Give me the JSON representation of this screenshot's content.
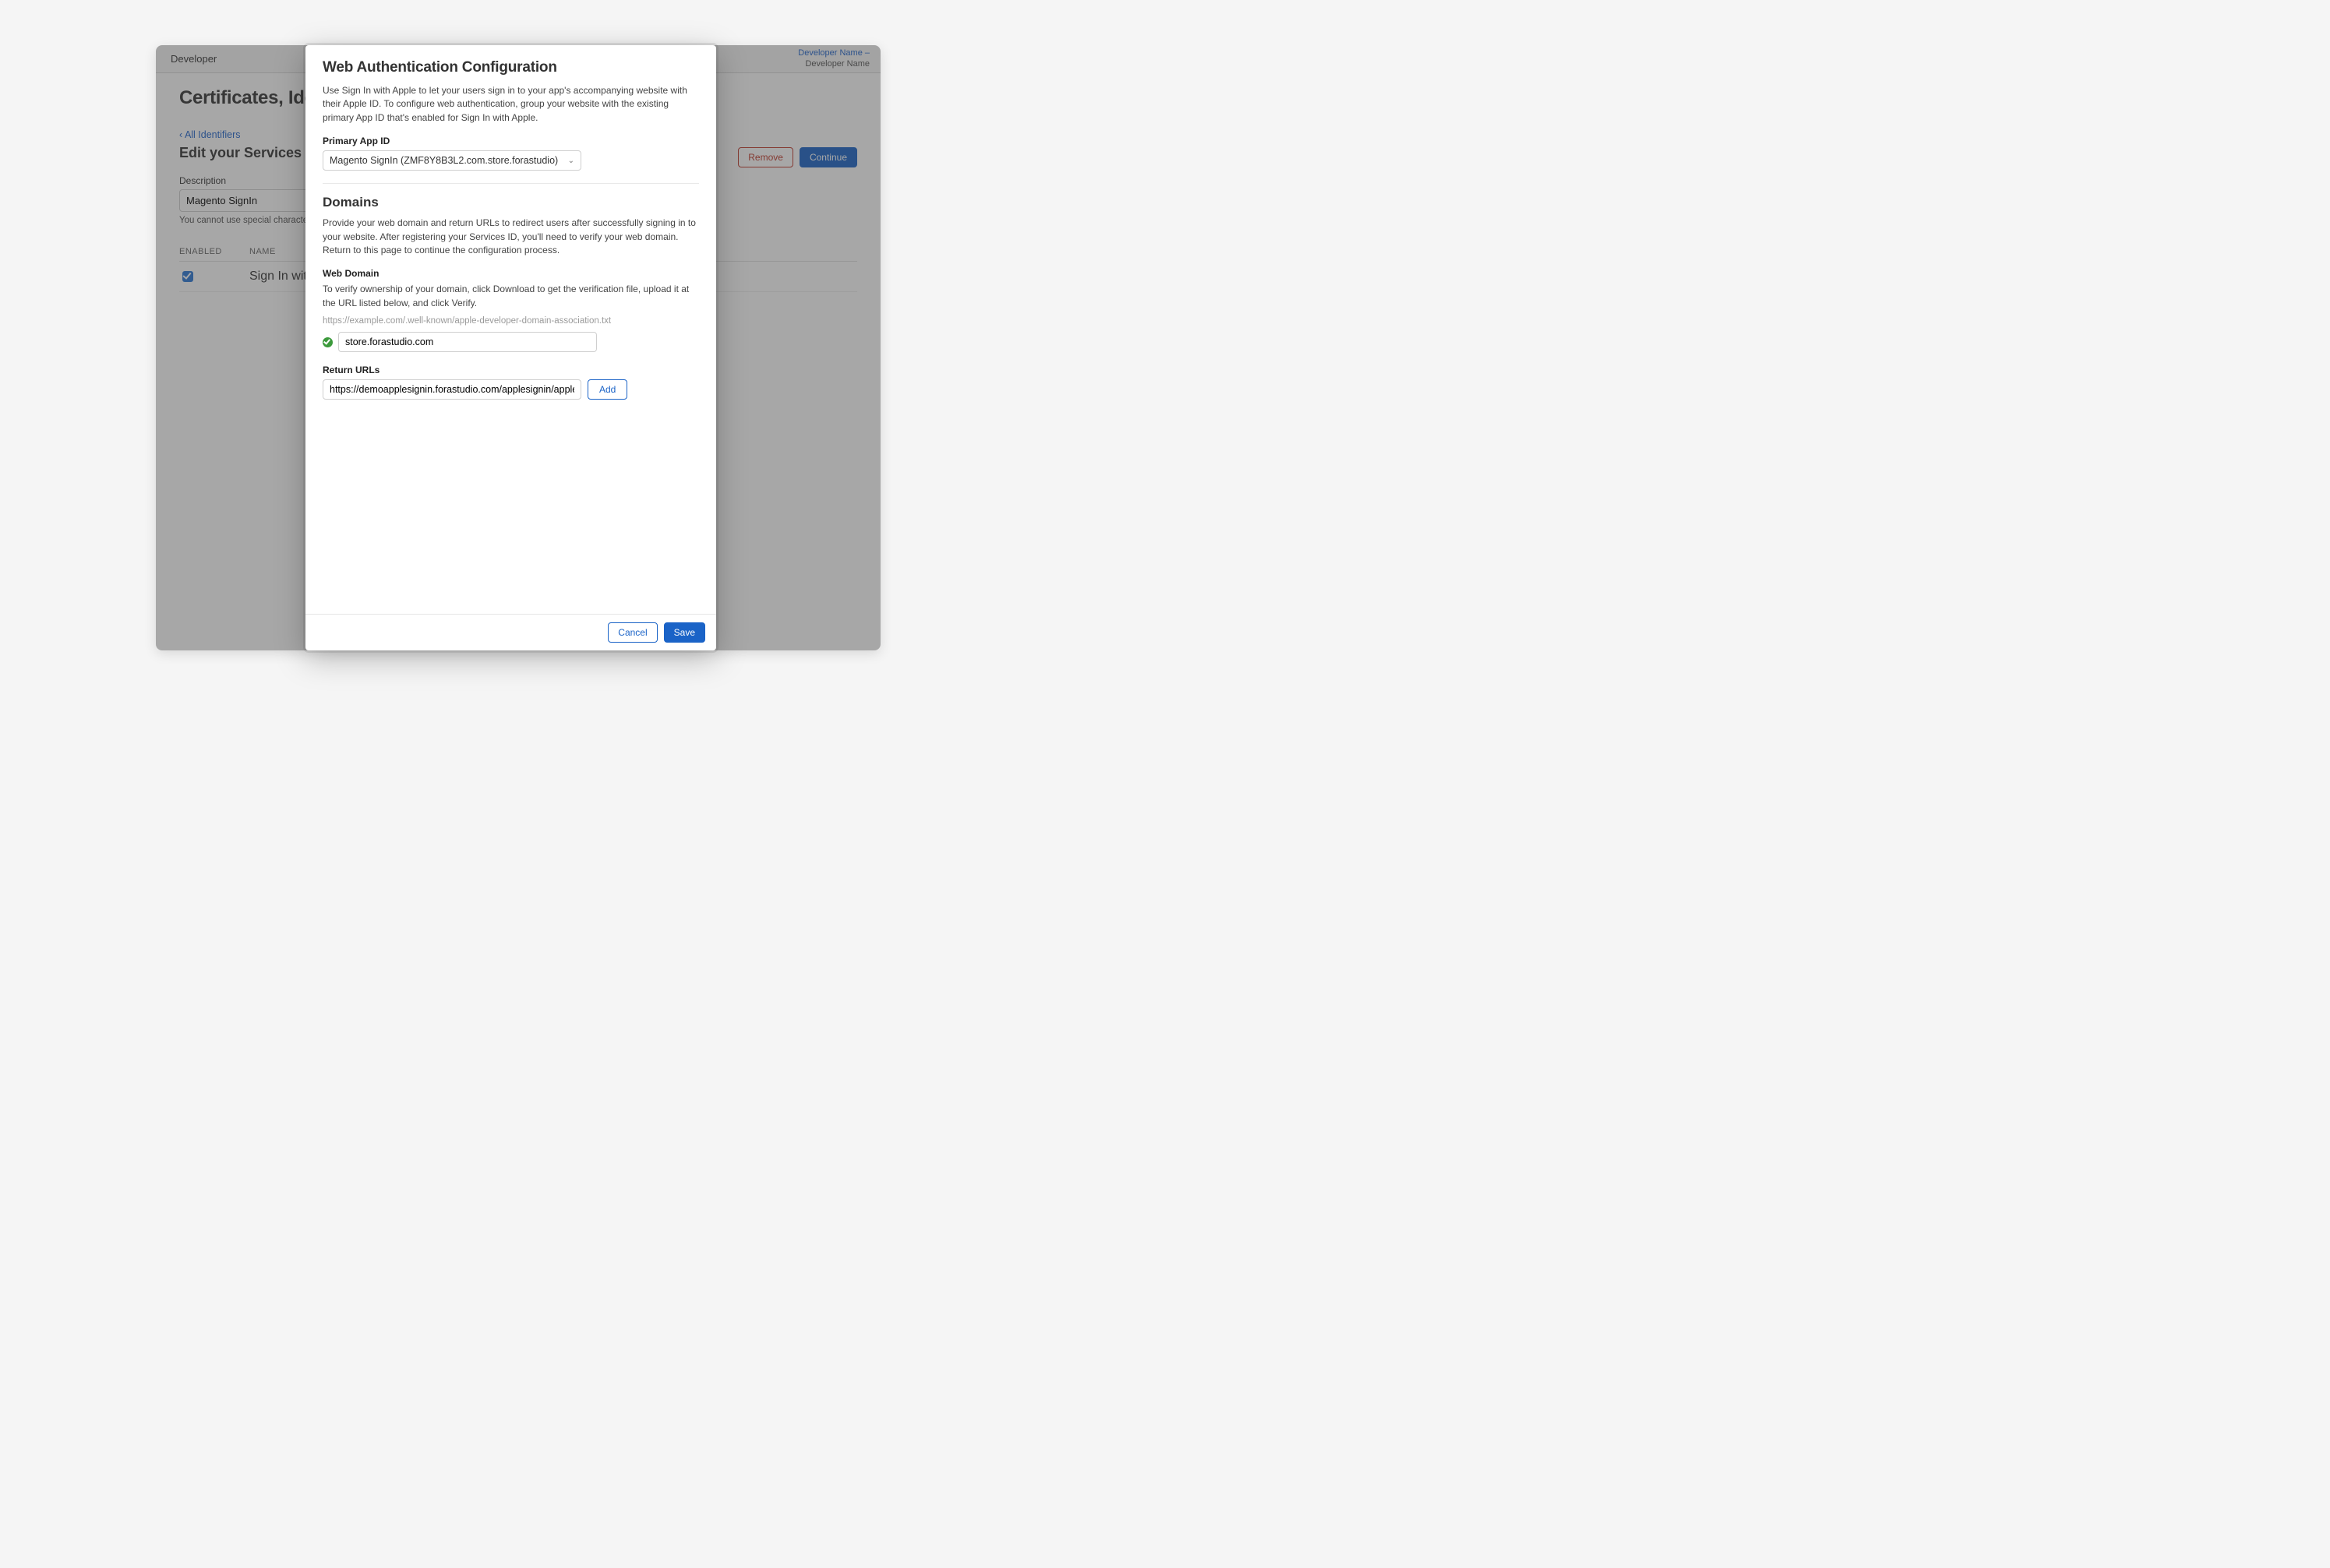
{
  "header": {
    "brand": "Developer",
    "account_line1": "Developer Name –",
    "account_line2": "Developer Name"
  },
  "page": {
    "title": "Certificates, Identifiers & Profiles",
    "back_link": "‹ All Identifiers",
    "subtitle": "Edit your Services ID Configuration",
    "remove_btn": "Remove",
    "continue_btn": "Continue",
    "description_label": "Description",
    "description_value": "Magento SignIn",
    "description_help": "You cannot use special characters such as @, &, *, \"",
    "cap_col_enabled": "ENABLED",
    "cap_col_name": "NAME",
    "cap_row_name": "Sign In with Apple"
  },
  "modal": {
    "title": "Web Authentication Configuration",
    "intro": "Use Sign In with Apple to let your users sign in to your app's accompanying website with their Apple ID. To configure web authentication, group your website with the existing primary App ID that's enabled for Sign In with Apple.",
    "primary_label": "Primary App ID",
    "primary_value": "Magento SignIn (ZMF8Y8B3L2.com.store.forastudio)",
    "domains_title": "Domains",
    "domains_intro": "Provide your web domain and return URLs to redirect users after successfully signing in to your website. After registering your Services ID, you'll need to verify your web domain. Return to this page to continue the configuration process.",
    "web_domain_label": "Web Domain",
    "web_domain_help": "To verify ownership of your domain, click Download to get the verification file, upload it at the URL listed below, and click Verify.",
    "web_domain_url_hint": "https://example.com/.well-known/apple-developer-domain-association.txt",
    "web_domain_value": "store.forastudio.com",
    "return_urls_label": "Return URLs",
    "return_url_value": "https://demoapplesignin.forastudio.com/applesignin/apple/login",
    "add_btn": "Add",
    "cancel_btn": "Cancel",
    "save_btn": "Save"
  }
}
